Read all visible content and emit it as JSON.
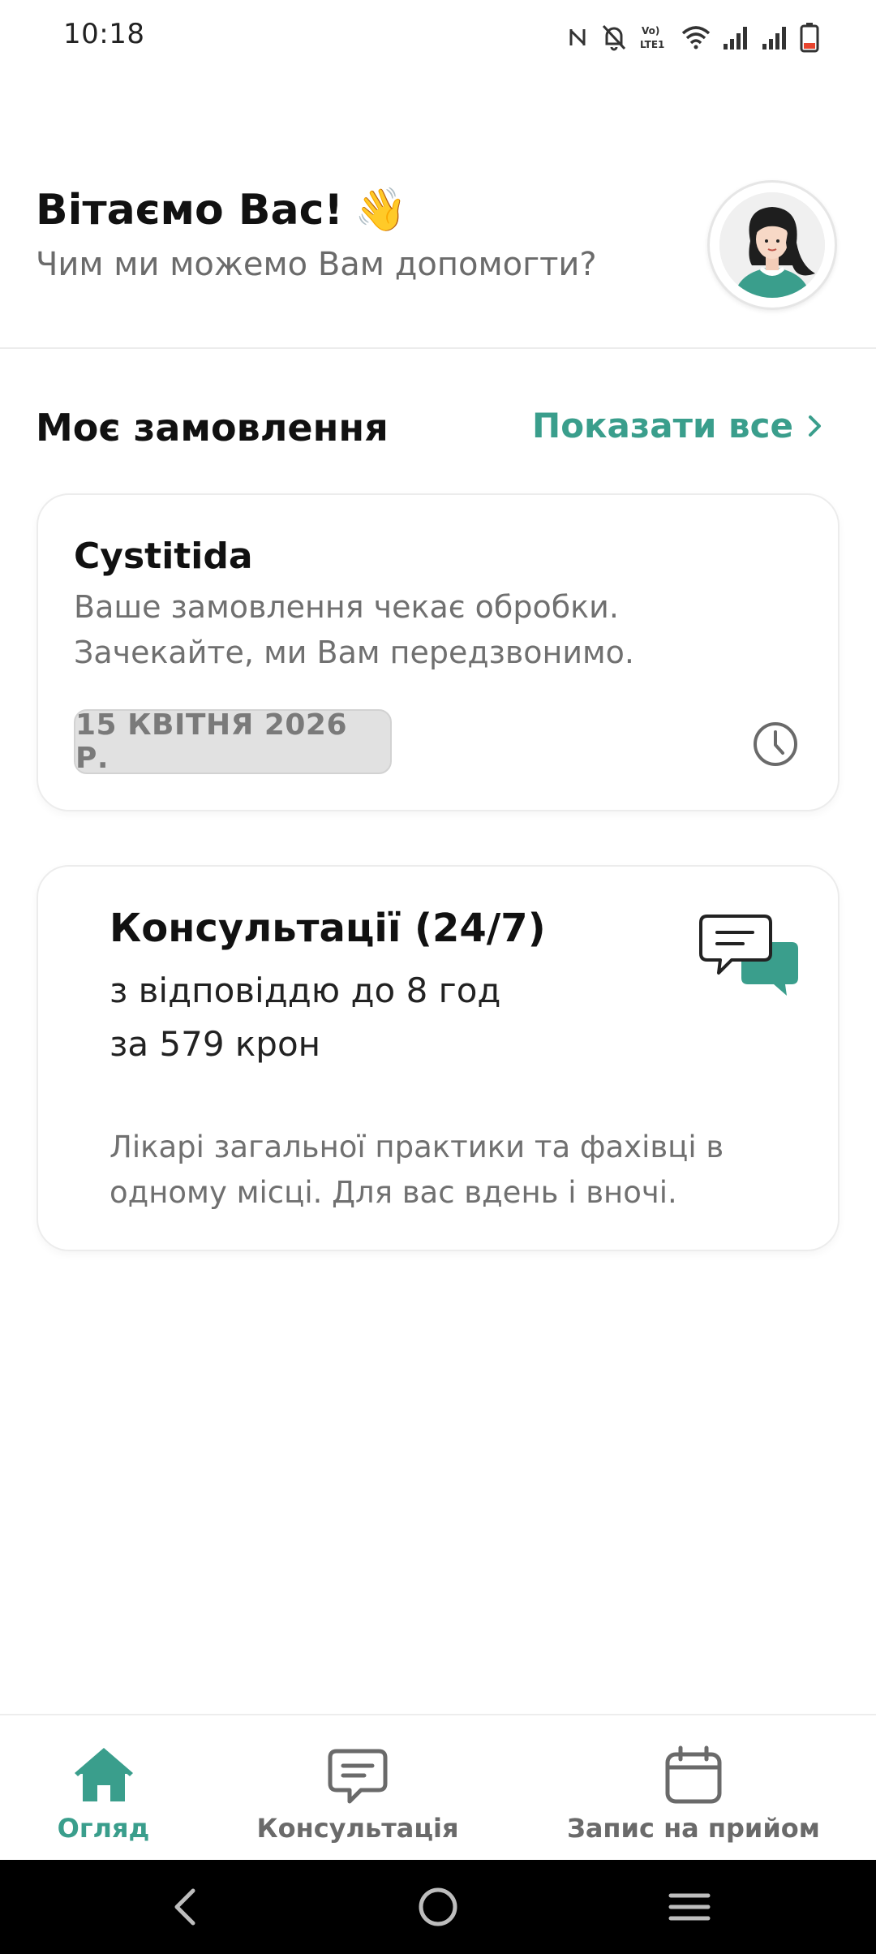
{
  "status_bar": {
    "time": "10:18",
    "icons": [
      "nfc-icon",
      "bell-off-icon",
      "volte-lte-icon",
      "wifi-icon",
      "signal-icon",
      "signal-icon",
      "battery-icon"
    ]
  },
  "header": {
    "title": "Вітаємо Вас!",
    "title_emoji": "👋",
    "subtitle": "Чим ми можемо Вам допомогти?"
  },
  "orders": {
    "section_title": "Моє замовлення",
    "show_all_label": "Показати все",
    "order": {
      "title": "Cystitida",
      "description": "Ваше замовлення чекає обробки. Зачекайте, ми Вам передзвонимо.",
      "date": "15 КВІТНЯ 2026 Р."
    }
  },
  "consultation_card": {
    "title": "Консультації (24/7)",
    "line1": "з відповіддю до 8 год",
    "line2": "за 579 крон",
    "description": "Лікарі загальної практики та фахівці в одному місці. Для вас вдень і вночі."
  },
  "bottom_nav": {
    "items": [
      {
        "label": "Огляд",
        "icon": "home-icon",
        "active": true
      },
      {
        "label": "Консультація",
        "icon": "chat-icon",
        "active": false
      },
      {
        "label": "Запис на прийом",
        "icon": "calendar-icon",
        "active": false
      }
    ]
  },
  "colors": {
    "accent": "#3a9e8c",
    "muted_text": "#707070",
    "border": "#ececec"
  }
}
